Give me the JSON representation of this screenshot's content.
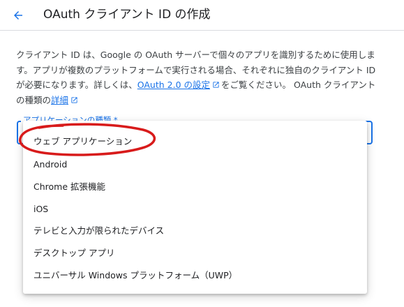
{
  "header": {
    "back_icon": "arrow-back-icon",
    "title": "OAuth クライアント ID の作成"
  },
  "description": {
    "text_before_link": "クライアント ID は、Google の OAuth サーバーで個々のアプリを識別するために使用します。アプリが複数のプラットフォームで実行される場合、それぞれに独自のクライアント ID が必要になります。詳しくは、",
    "settings_link": "OAuth 2.0 の設定",
    "text_middle": "をご覧ください。 OAuth クライアントの種類の",
    "details_link": "詳細"
  },
  "form": {
    "application_type_label": "アプリケーションの種類 *"
  },
  "menu": {
    "options": [
      "ウェブ アプリケーション",
      "Android",
      "Chrome 拡張機能",
      "iOS",
      "テレビと入力が限られたデバイス",
      "デスクトップ アプリ",
      "ユニバーサル Windows プラットフォーム（UWP）"
    ]
  },
  "colors": {
    "accent": "#1a73e8",
    "annotation": "#d81b1b"
  }
}
